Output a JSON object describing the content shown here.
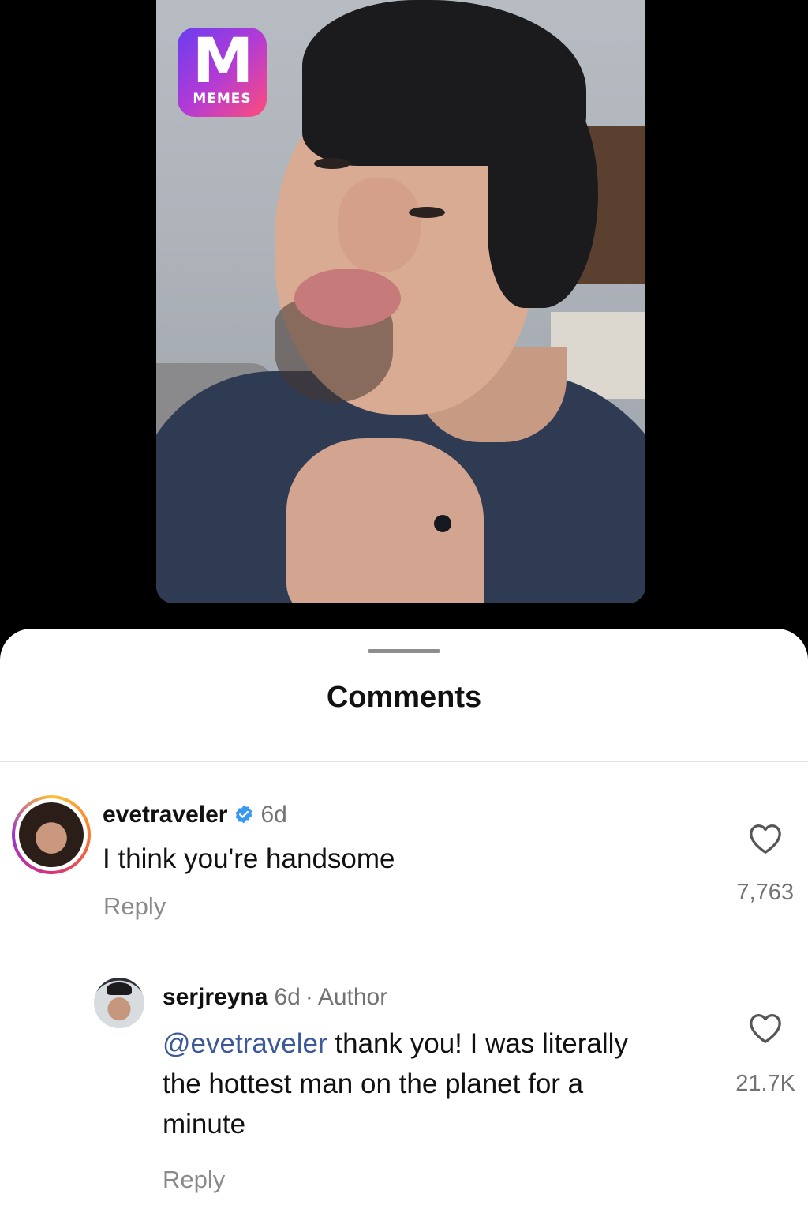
{
  "logo": {
    "letter": "M",
    "word": "MEMES",
    "icon": "memes-logo-icon"
  },
  "sheet": {
    "title": "Comments"
  },
  "comments": [
    {
      "username": "evetraveler",
      "verified": true,
      "time": "6d",
      "text": "I think you're handsome",
      "reply_label": "Reply",
      "likes": "7,763"
    },
    {
      "username": "serjreyna",
      "time": "6d",
      "separator": "·",
      "badge": "Author",
      "mention": "@evetraveler",
      "text_line1": " thank you! I was literally",
      "text_line2": "the hottest man on the planet for a",
      "text_line3": "minute",
      "reply_label": "Reply",
      "likes": "21.7K"
    }
  ],
  "colors": {
    "mention": "#3c5a9a",
    "verified": "#3897f0",
    "muted": "#737373"
  }
}
